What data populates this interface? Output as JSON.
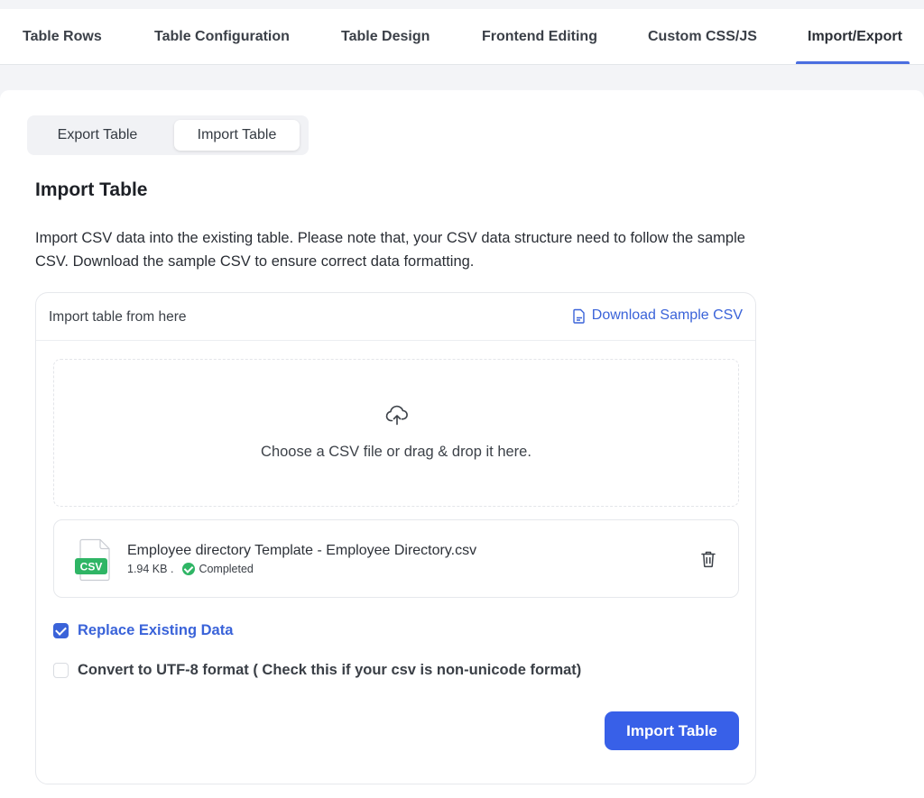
{
  "tabs": [
    {
      "label": "Table Rows"
    },
    {
      "label": "Table Configuration"
    },
    {
      "label": "Table Design"
    },
    {
      "label": "Frontend Editing"
    },
    {
      "label": "Custom CSS/JS"
    },
    {
      "label": "Import/Export"
    }
  ],
  "active_tab": "Import/Export",
  "segment": {
    "export_label": "Export Table",
    "import_label": "Import Table",
    "selected": "Import Table"
  },
  "section": {
    "title": "Import Table",
    "description": "Import CSV data into the existing table. Please note that, your CSV data structure need to follow the sample CSV. Download the sample CSV to ensure correct data formatting."
  },
  "card": {
    "header_label": "Import table from here",
    "download_label": "Download Sample CSV",
    "dropzone_text": "Choose a CSV file or drag & drop it here."
  },
  "file": {
    "badge": "CSV",
    "name": "Employee directory Template - Employee Directory.csv",
    "size": "1.94 KB .",
    "status": "Completed"
  },
  "options": {
    "replace_label": "Replace Existing Data",
    "replace_checked": true,
    "utf_label": "Convert to UTF-8 format ( Check this if your csv is non-unicode format)",
    "utf_checked": false
  },
  "submit_label": "Import Table",
  "colors": {
    "accent": "#3860e8",
    "link": "#3a63d9",
    "success": "#2fb565"
  }
}
